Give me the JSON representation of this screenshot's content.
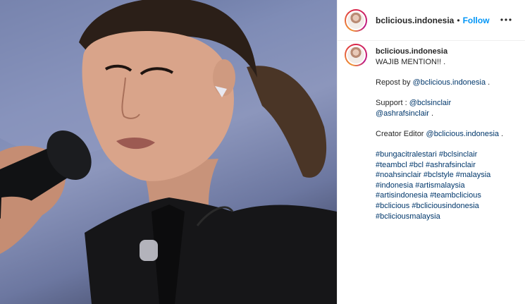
{
  "post": {
    "username": "bclicious.indonesia",
    "dot": "•",
    "follow_label": "Follow",
    "more_icon": "more-dots-icon"
  },
  "caption": {
    "username": "bclicious.indonesia",
    "line1": "WAJIB MENTION!! .",
    "repost_prefix": "Repost by ",
    "repost_handle": "@bclicious.indonesia",
    "repost_suffix": " .",
    "support_prefix": "Support : ",
    "support_handle1": "@bclsinclair",
    "support_handle2": "@ashrafsinclair",
    "support_suffix": " .",
    "editor_prefix": "Creator Editor ",
    "editor_handle": "@bclicious.indonesia",
    "editor_suffix": " .",
    "hashtags": [
      "#bungacitralestari",
      "#bclsinclair",
      "#teambcl",
      "#bcl",
      "#ashrafsinclair",
      "#noahsinclair",
      "#bclstyle",
      "#malaysia",
      "#indonesia",
      "#artismalaysia",
      "#artisindonesia",
      "#teambclicious",
      "#bclicious",
      "#bcliciousindonesia",
      "#bcliciousmalaysia"
    ]
  },
  "colors": {
    "link": "#00376b",
    "follow": "#0095f6",
    "text": "#262626"
  }
}
